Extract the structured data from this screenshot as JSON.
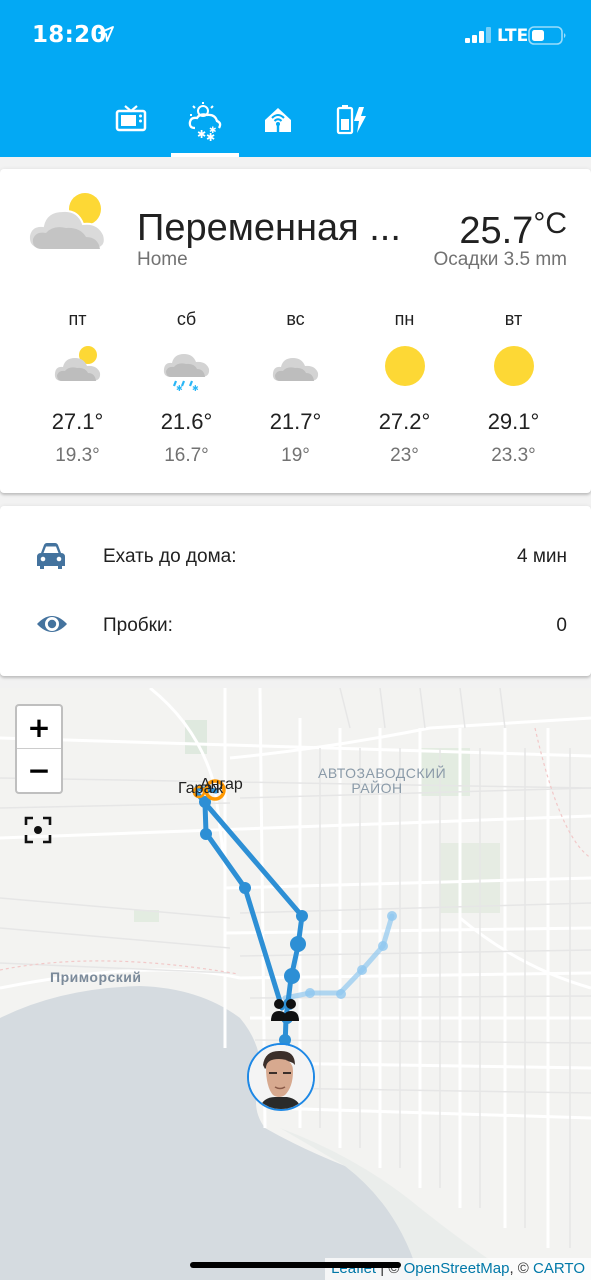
{
  "status_bar": {
    "time": "18:20",
    "network": "LTE"
  },
  "tabs": [
    {
      "icon": "tv-icon"
    },
    {
      "icon": "weather-partly-snowy-icon",
      "selected": true
    },
    {
      "icon": "home-automation-icon"
    },
    {
      "icon": "battery-charging-icon"
    }
  ],
  "colors": {
    "header": "#03a9f4",
    "route": "#2d8fd5",
    "sun": "#fdd835",
    "icon_gray": "#44739e"
  },
  "weather": {
    "condition": "Переменная ...",
    "location": "Home",
    "temperature": "25.7",
    "unit": "°C",
    "precipitation": "Осадки 3.5 mm",
    "forecast": [
      {
        "day": "пт",
        "icon": "partly-cloudy-icon",
        "high": "27.1°",
        "low": "19.3°"
      },
      {
        "day": "сб",
        "icon": "snowy-rainy-icon",
        "high": "21.6°",
        "low": "16.7°"
      },
      {
        "day": "вс",
        "icon": "cloudy-icon",
        "high": "21.7°",
        "low": "19°"
      },
      {
        "day": "пн",
        "icon": "sunny-icon",
        "high": "27.2°",
        "low": "23°"
      },
      {
        "day": "вт",
        "icon": "sunny-icon",
        "high": "29.1°",
        "low": "23.3°"
      }
    ]
  },
  "info": {
    "drive_label": "Ехать до дома:",
    "drive_value": "4 мин",
    "traffic_label": "Пробки:",
    "traffic_value": "0"
  },
  "map": {
    "zoom_in": "+",
    "zoom_out": "−",
    "district_label": "АВТОЗАВОДСКИЙ РАЙОН",
    "primorsky_label": "Приморский",
    "zone_garage": "Гараж",
    "zone_hangar": "Ангар",
    "attribution_leaflet": "Leaflet",
    "attribution_sep1": " | © ",
    "attribution_osm": "OpenStreetMap",
    "attribution_sep2": ", © ",
    "attribution_carto": "CARTO"
  }
}
